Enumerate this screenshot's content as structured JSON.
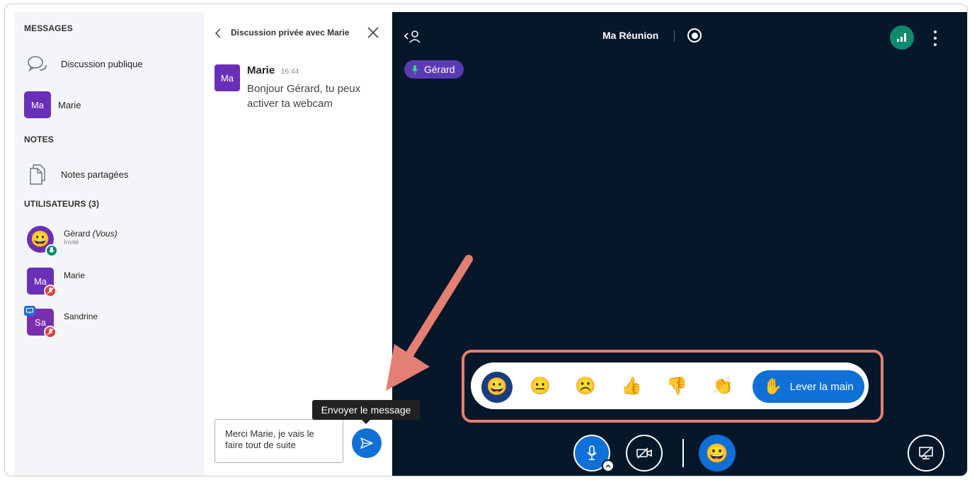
{
  "sidebar": {
    "messages_title": "MESSAGES",
    "public_chat_label": "Discussion publique",
    "private_chat": {
      "avatar": "Ma",
      "label": "Marie"
    },
    "notes_title": "NOTES",
    "shared_notes_label": "Notes partagées",
    "users_title": "UTILISATEURS (3)",
    "users": [
      {
        "name": "Gérard",
        "you": "(Vous)",
        "role": "Invité",
        "avatar": "😀",
        "status": "microphone-on",
        "status_color": "#0f8a6e"
      },
      {
        "name": "Marie",
        "avatar": "Ma",
        "status": "microphone-muted",
        "status_color": "#df3d3d"
      },
      {
        "name": "Sandrine",
        "avatar": "Sa",
        "status": "microphone-muted",
        "status_color": "#df3d3d",
        "presenter_icon": "presentation-icon"
      }
    ]
  },
  "chat": {
    "title": "Discussion privée avec Marie",
    "message": {
      "avatar": "Ma",
      "author": "Marie",
      "time": "16:44",
      "text": "Bonjour Gérard, tu peux activer ta webcam"
    },
    "input_value": "Merci Marie, je vais le faire tout de suite",
    "tooltip": "Envoyer le message"
  },
  "main": {
    "meeting_title": "Ma Réunion",
    "talking_user": "Gérard",
    "reactions": [
      {
        "name": "smiley",
        "icon": "😀"
      },
      {
        "name": "neutral",
        "icon": "😐"
      },
      {
        "name": "sad",
        "icon": "☹️"
      },
      {
        "name": "thumbs-up",
        "icon": "👍"
      },
      {
        "name": "thumbs-down",
        "icon": "👎"
      },
      {
        "name": "applause",
        "icon": "👏"
      }
    ],
    "raise_hand_label": "Lever la main",
    "raise_hand_icon": "✋",
    "reaction_button_icon": "😀"
  },
  "colors": {
    "accent": "#0f70d7",
    "avatar_purple": "#6a2fb8",
    "dark_bg": "#06172a",
    "annotation": "#e47f73"
  }
}
